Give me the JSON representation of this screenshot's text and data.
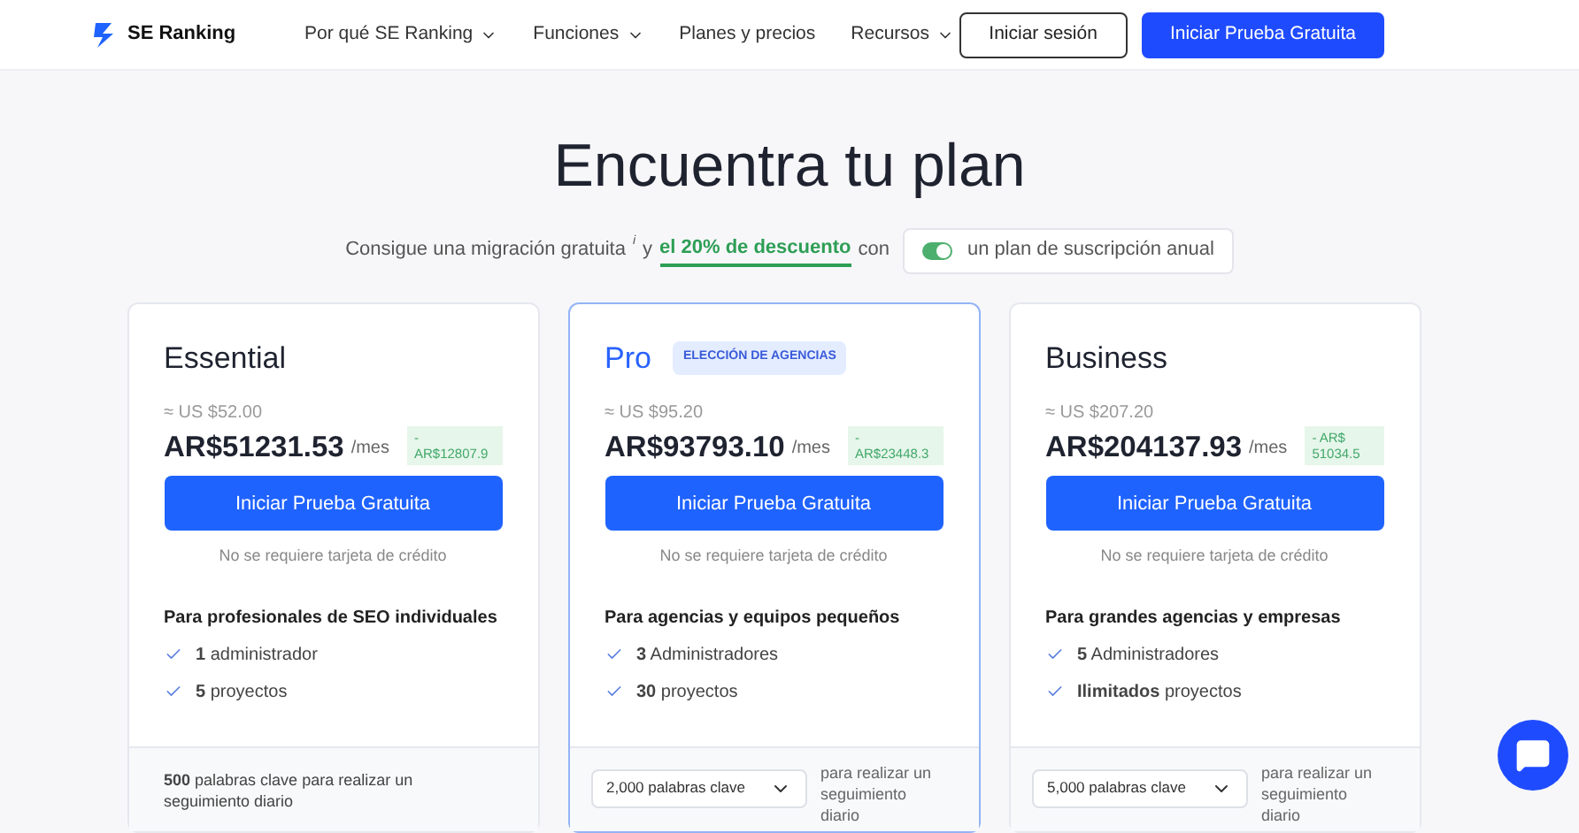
{
  "nav": {
    "logo": "SE Ranking",
    "items": [
      {
        "label": "Por qué SE Ranking",
        "dropdown": true
      },
      {
        "label": "Funciones",
        "dropdown": true
      },
      {
        "label": "Planes y precios",
        "dropdown": false
      },
      {
        "label": "Recursos",
        "dropdown": true
      }
    ],
    "login": "Iniciar sesión",
    "cta": "Iniciar Prueba Gratuita"
  },
  "heading": "Encuentra tu plan",
  "offer": {
    "before": "Consigue una migración gratuita",
    "note": "i",
    "middle": "y",
    "highlight": "el 20% de descuento",
    "after": "con",
    "toggle_on": true,
    "toggle_label": "un plan de suscripción anual"
  },
  "plans": [
    {
      "name": "Essential",
      "featured": false,
      "usd": "≈ US $52.00",
      "price": "AR$51231.53",
      "period": "/mes",
      "discount": "- AR$12807.9",
      "button": "Iniciar Prueba Gratuita",
      "note": "No se requiere tarjeta de crédito",
      "audience": "Para profesionales de SEO individuales",
      "features": [
        "**1** administrador",
        "**5** proyectos"
      ],
      "keywords": {
        "kind": "text",
        "text": "**500**  palabras clave para realizar un seguimiento diario"
      }
    },
    {
      "name": "Pro",
      "featured": true,
      "badge": "ELECCIÓN DE AGENCIAS",
      "usd": "≈ US $95.20",
      "price": "AR$93793.10",
      "period": "/mes",
      "discount": "- AR$23448.3",
      "button": "Iniciar Prueba Gratuita",
      "note": "No se requiere tarjeta de crédito",
      "audience": "Para agencias y equipos pequeños",
      "features": [
        "**3** Administradores",
        "**30** proyectos"
      ],
      "keywords": {
        "kind": "select",
        "value": "2,000 palabras clave",
        "text": "para realizar un seguimiento diario"
      }
    },
    {
      "name": "Business",
      "featured": false,
      "usd": "≈ US $207.20",
      "price": "AR$204137.93",
      "period": "/mes",
      "discount": "- AR$ 51034.5",
      "button": "Iniciar Prueba Gratuita",
      "note": "No se requiere tarjeta de crédito",
      "audience": "Para grandes agencias y empresas",
      "features": [
        "**5** Administradores",
        "**Ilimitados** proyectos"
      ],
      "keywords": {
        "kind": "select",
        "value": "5,000 palabras clave",
        "text": "para realizar un seguimiento diario"
      }
    }
  ]
}
